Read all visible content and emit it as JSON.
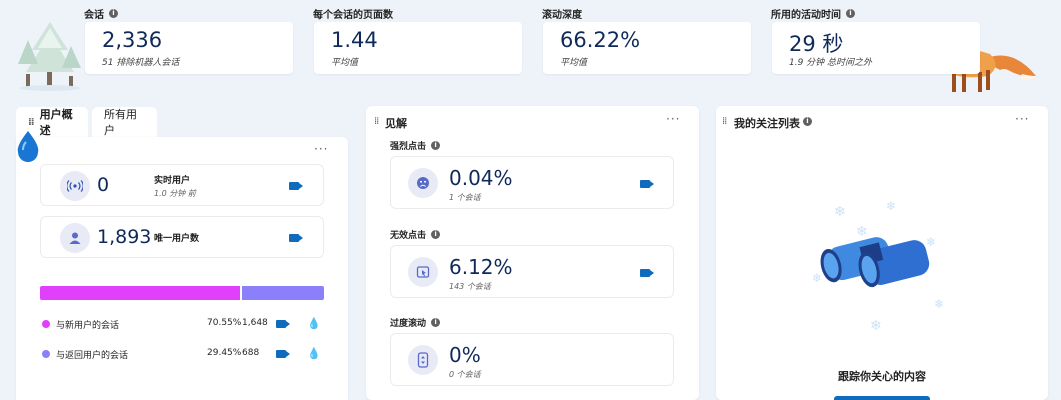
{
  "metrics": [
    {
      "label": "会话",
      "value": "2,336",
      "sub": "51 排除机器人会话",
      "info": "i"
    },
    {
      "label": "每个会话的页面数",
      "value": "1.44",
      "sub": "平均值"
    },
    {
      "label": "滚动深度",
      "value": "66.22%",
      "sub": "平均值"
    },
    {
      "label": "所用的活动时间",
      "value": "29 秒",
      "sub": "1.9 分钟 总时间之外",
      "info": "i"
    }
  ],
  "tabs": {
    "overview": "用户概述",
    "all_users": "所有用户"
  },
  "overview": {
    "more": "···",
    "realtime": {
      "value": "0",
      "label": "实时用户",
      "sub": "1.0 分钟 前"
    },
    "unique": {
      "value": "1,893",
      "label": "唯一用户数"
    },
    "split": {
      "new_fraction": 0.7055,
      "new_color": "#e040fb",
      "returning_color": "#8b80f9"
    },
    "legend": [
      {
        "label": "与新用户的会话",
        "percent": "70.55%",
        "count": "1,648"
      },
      {
        "label": "与返回用户的会话",
        "percent": "29.45%",
        "count": "688"
      }
    ]
  },
  "insights": {
    "title": "见解",
    "more": "···",
    "items": [
      {
        "label": "强烈点击",
        "value": "0.04%",
        "sub": "1 个会话",
        "icon": "angry-face-icon"
      },
      {
        "label": "无效点击",
        "value": "6.12%",
        "sub": "143 个会话",
        "icon": "dead-click-icon"
      },
      {
        "label": "过度滚动",
        "value": "0%",
        "sub": "0 个会话",
        "icon": "scroll-icon"
      }
    ]
  },
  "watchlist": {
    "title": "我的关注列表",
    "more": "···",
    "empty_text": "跟踪你关心的内容"
  },
  "colors": {
    "accent": "#0f6cbd",
    "navy": "#0f2a5a"
  }
}
